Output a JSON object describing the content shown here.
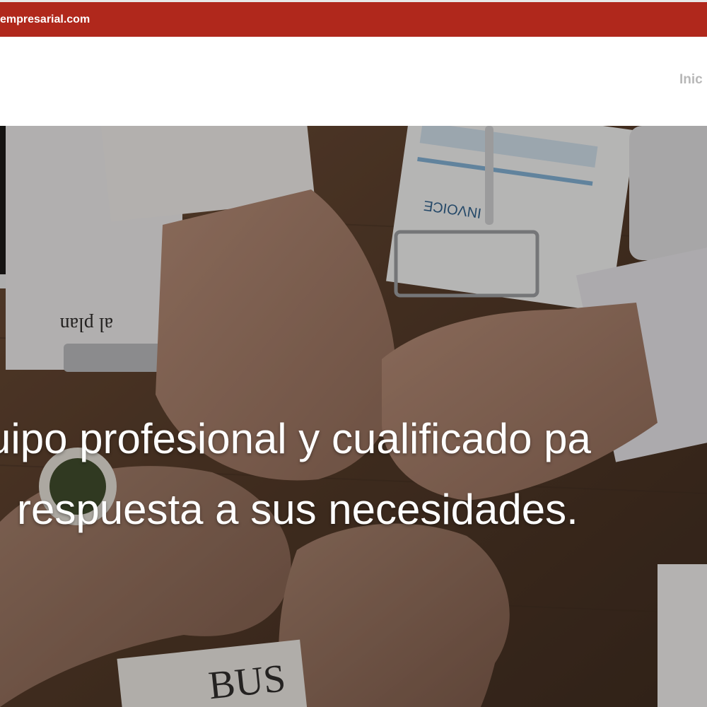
{
  "topbar": {
    "email_text": "empresarial.com",
    "color": "#b0281c"
  },
  "header": {
    "nav": [
      {
        "label": "Inic"
      }
    ]
  },
  "hero": {
    "headline_line1": "uipo profesional y cualificado pa",
    "headline_line2": "respuesta a sus necesidades.",
    "image_subject": "team-fist-bump-on-desk"
  }
}
